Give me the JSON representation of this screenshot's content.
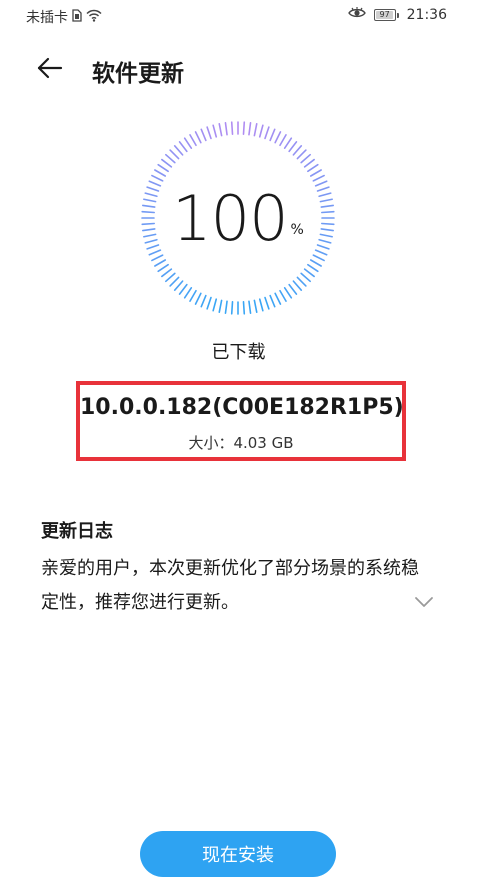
{
  "status_bar": {
    "carrier": "未插卡",
    "battery_level": "97",
    "time": "21:36"
  },
  "header": {
    "back_icon": "arrow-left-icon",
    "title": "软件更新"
  },
  "progress": {
    "value": "100",
    "unit": "%",
    "fraction": 1.0,
    "status": "已下载"
  },
  "colors": {
    "ring_start": "#b38cf2",
    "ring_end": "#3aa6f5",
    "highlight_border": "#e8323a",
    "button": "#2ea3f2"
  },
  "version": {
    "number": "10.0.0.182(C00E182R1P5)",
    "size": "大小：4.03 GB"
  },
  "changelog": {
    "title": "更新日志",
    "text": "亲爱的用户，本次更新优化了部分场景的系统稳定性，推荐您进行更新。",
    "expand_icon": "chevron-down-icon"
  },
  "install_button": {
    "label": "现在安装"
  }
}
